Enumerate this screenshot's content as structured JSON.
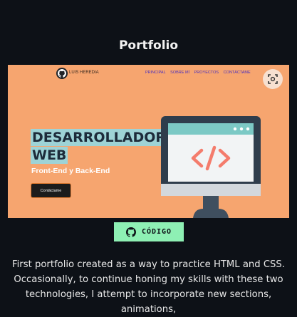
{
  "section": {
    "title": "Portfolio"
  },
  "preview": {
    "site_name": "LUIS HEREDIA",
    "nav_links": [
      "PRINCIPAL",
      "SOBRE MÍ",
      "PROYECTOS",
      "CONTÁCTAME"
    ],
    "hero_title_line1": "DESARROLLADOR",
    "hero_title_line2": "WEB",
    "hero_subtitle": "Front-End y Back-End",
    "hero_button": "Contáctame",
    "zoom_icon": "fullscreen-icon",
    "background_color": "#f6a56f"
  },
  "code_button": {
    "label": "CÓDIGO",
    "icon": "github-icon",
    "color": "#8ef0b4"
  },
  "description": {
    "text": "First portfolio created as a way to practice HTML and CSS. Occasionally, to continue honing my skills with these two technologies, I attempt to incorporate new sections, animations,"
  }
}
